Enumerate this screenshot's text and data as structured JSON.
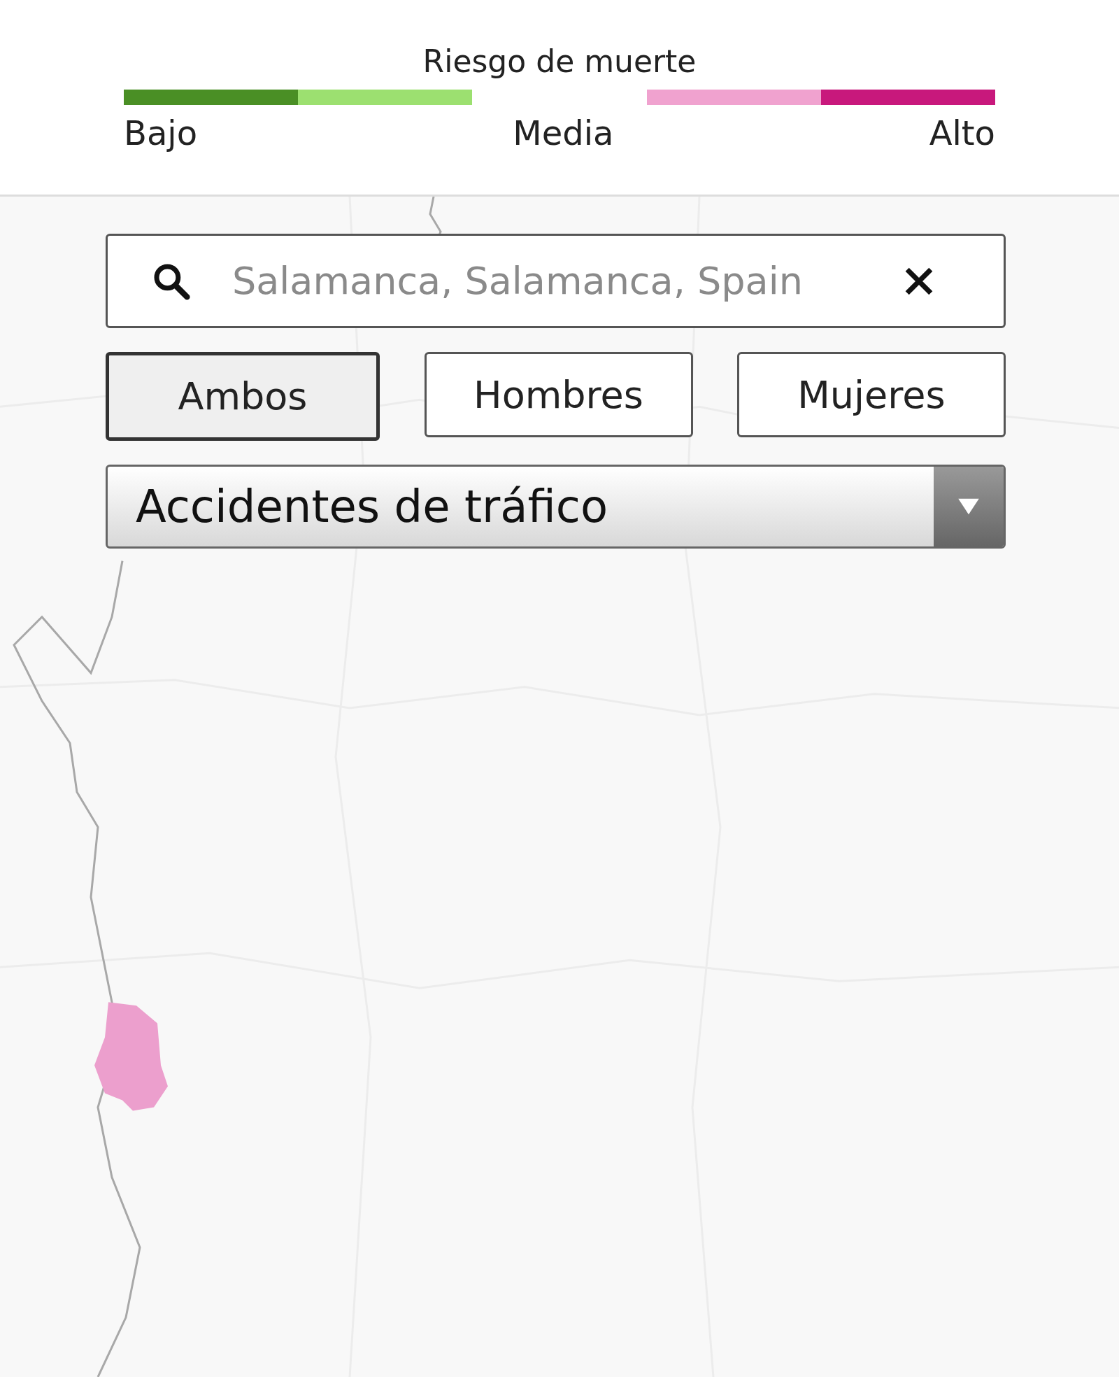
{
  "legend": {
    "title": "Riesgo de muerte",
    "segments": [
      {
        "color": "#4a8f25"
      },
      {
        "color": "#9ce070"
      },
      {
        "color": "#f0a2cf"
      },
      {
        "color": "#c8187c"
      }
    ],
    "labels": [
      "Bajo",
      "Media",
      "Alto"
    ]
  },
  "search": {
    "value": "Salamanca, Salamanca, Spain"
  },
  "sex_filter": [
    {
      "label": "Ambos",
      "selected": true
    },
    {
      "label": "Hombres",
      "selected": false
    },
    {
      "label": "Mujeres",
      "selected": false
    }
  ],
  "cause_dropdown": {
    "value": "Accidentes de tráfico"
  }
}
